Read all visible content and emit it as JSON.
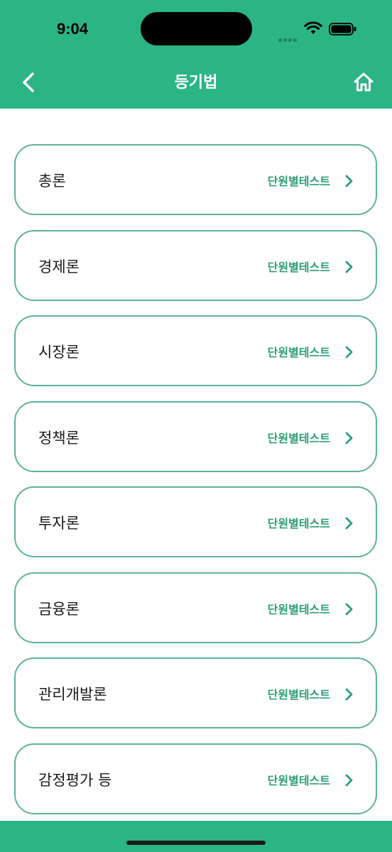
{
  "status_bar": {
    "time": "9:04"
  },
  "header": {
    "title": "등기법"
  },
  "icons": {
    "back": "chevron-left-icon",
    "home": "home-icon",
    "item": "chevron-right-icon"
  },
  "colors": {
    "primary": "#2bb585",
    "border": "#5fb394",
    "link": "#2e9f73"
  },
  "items": [
    {
      "title": "총론",
      "link": "단원별테스트"
    },
    {
      "title": "경제론",
      "link": "단원별테스트"
    },
    {
      "title": "시장론",
      "link": "단원별테스트"
    },
    {
      "title": "정책론",
      "link": "단원별테스트"
    },
    {
      "title": "투자론",
      "link": "단원별테스트"
    },
    {
      "title": "금융론",
      "link": "단원별테스트"
    },
    {
      "title": "관리개발론",
      "link": "단원별테스트"
    },
    {
      "title": "감정평가 등",
      "link": "단원별테스트"
    }
  ]
}
